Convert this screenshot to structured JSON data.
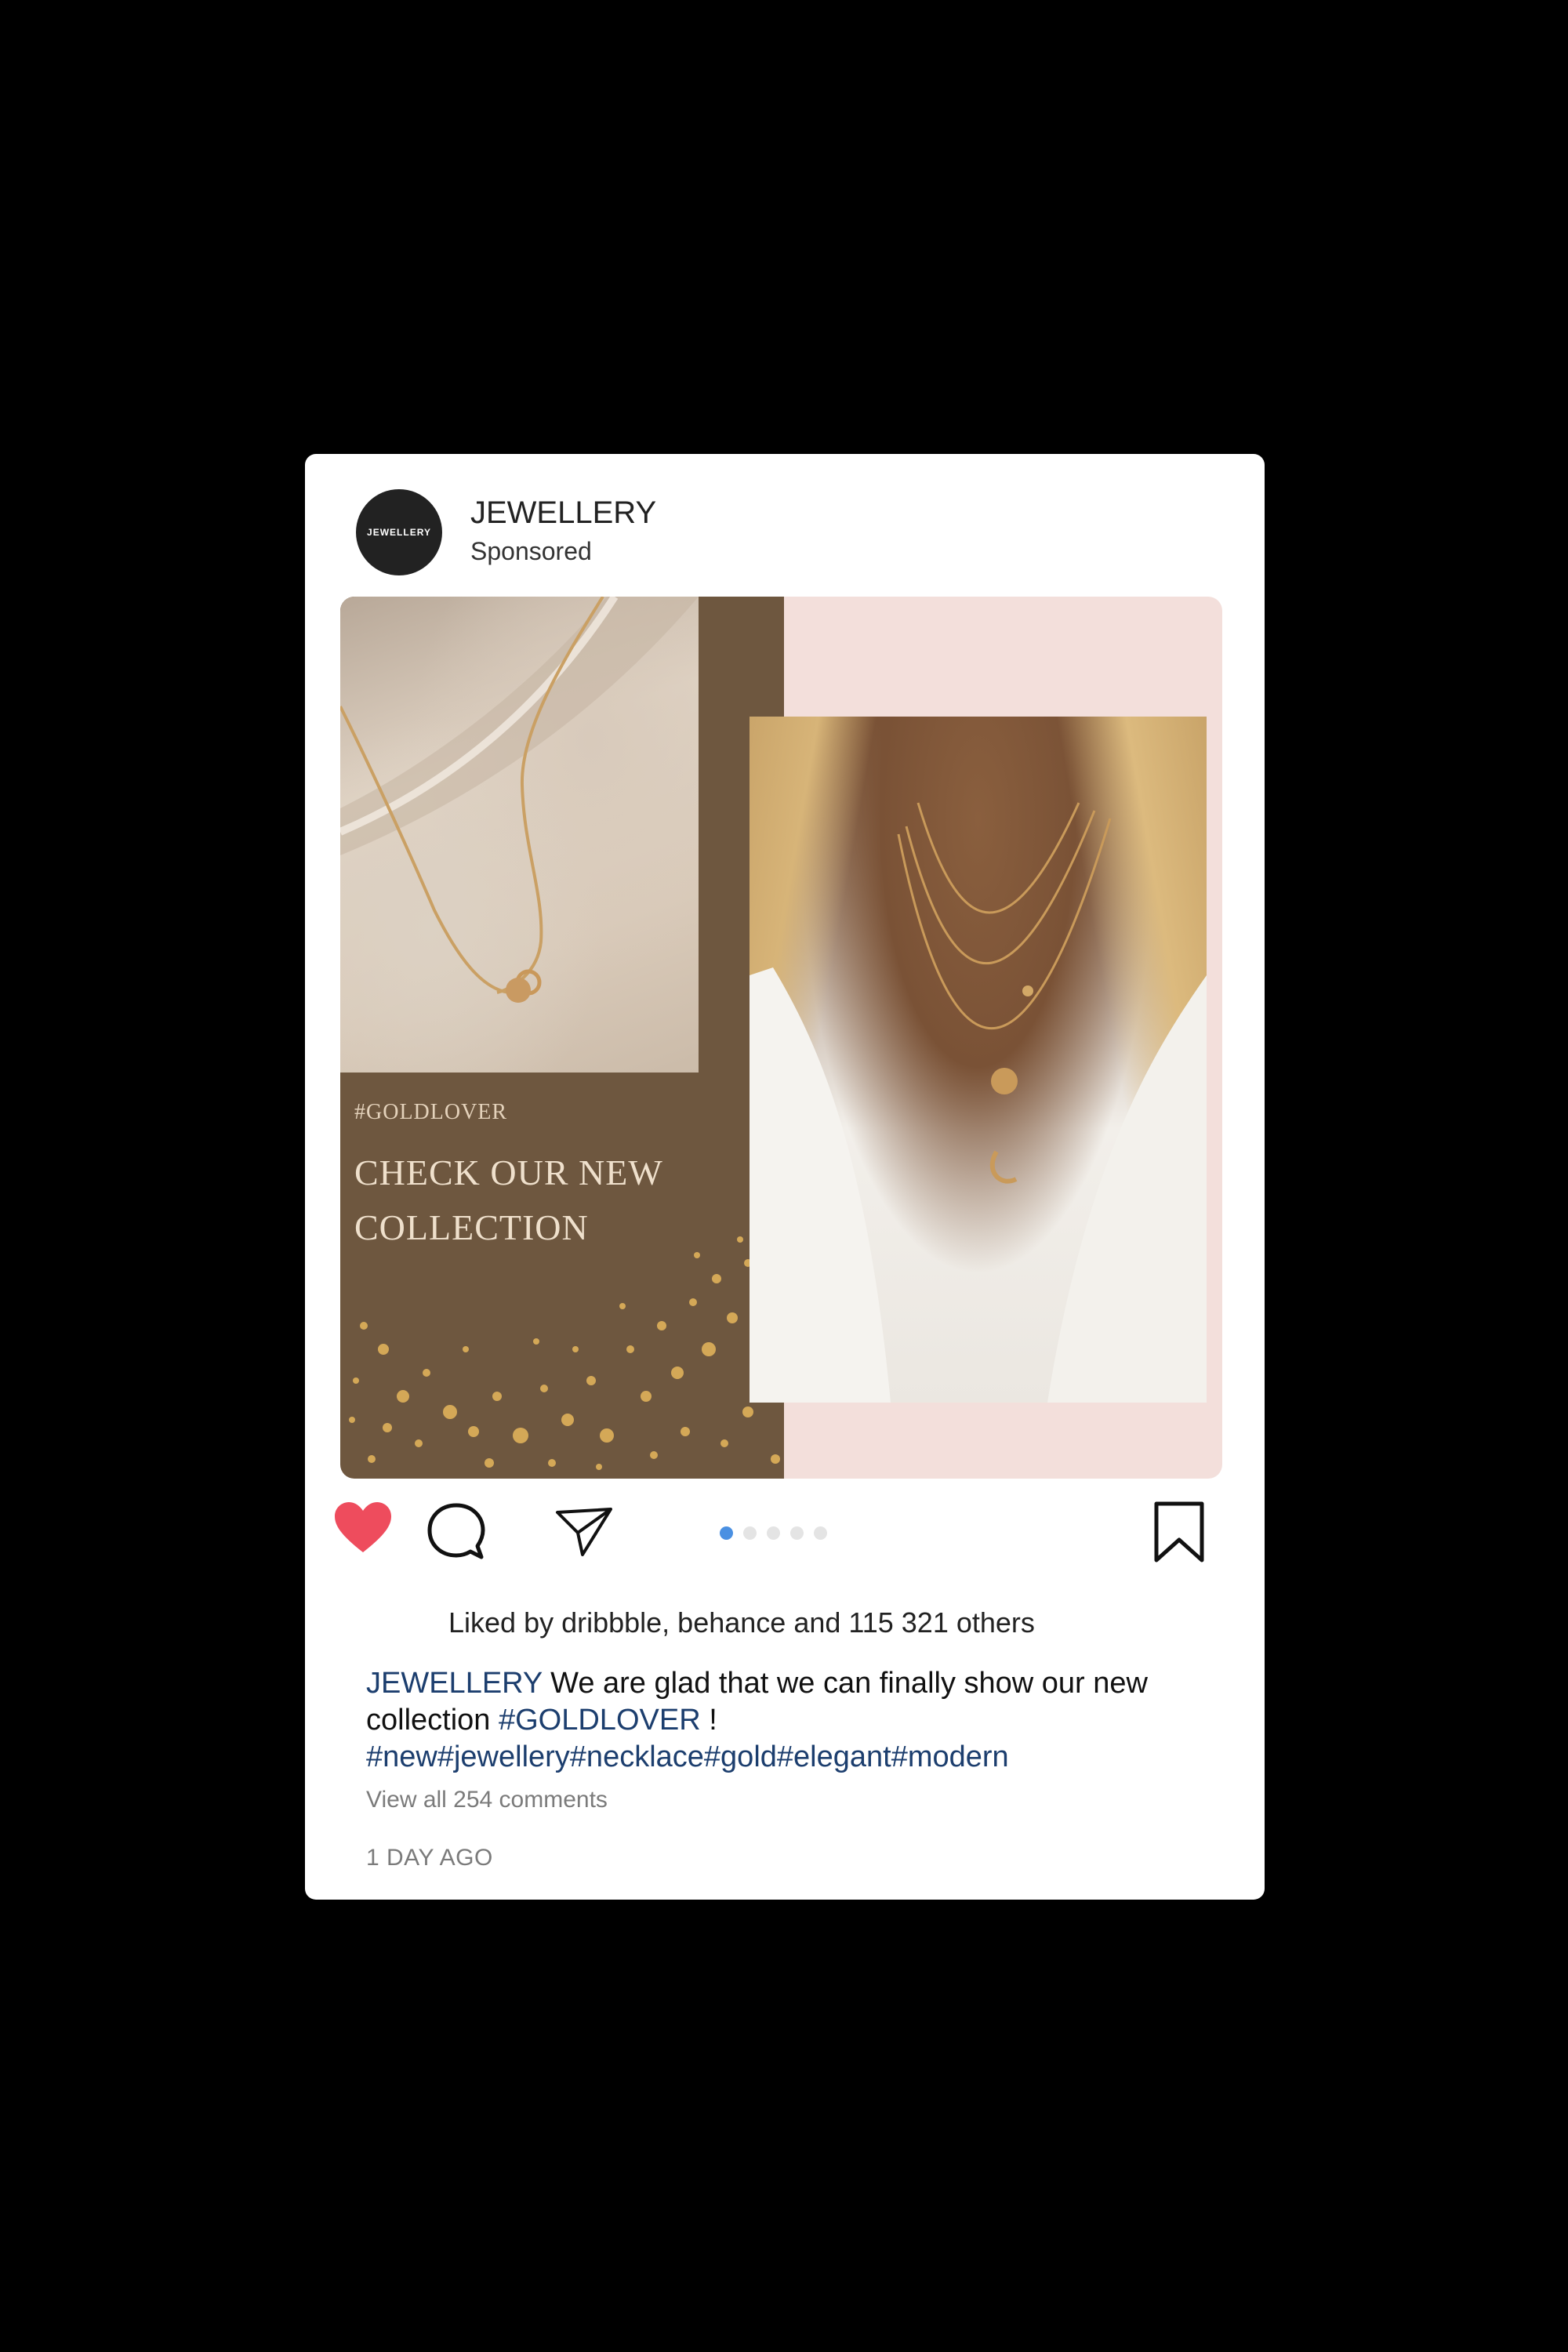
{
  "account": {
    "name": "JEWELLERY",
    "subtitle": "Sponsored",
    "avatar_text": "JEWELLERY"
  },
  "media": {
    "tagline": "#GOLDLOVER",
    "headline": "CHECK OUR NEW COLLECTION",
    "colors": {
      "brown_panel": "#6e573f",
      "pink_background": "#f3dfdb",
      "gold": "#d4a857"
    }
  },
  "actions": {
    "like_icon": "heart-icon",
    "comment_icon": "comment-icon",
    "share_icon": "send-icon",
    "save_icon": "bookmark-icon",
    "carousel_total": 5,
    "carousel_active": 1,
    "like_color": "#ee4c5d",
    "active_dot_color": "#4a90e2"
  },
  "likes_text": "Liked by dribbble, behance and 115 321 others",
  "caption": {
    "account": "JEWELLERY",
    "text": " We are glad that we can finally show our new collection ",
    "hashtag": "#GOLDLOVER",
    "end": " !",
    "tags": "#new#jewellery#necklace#gold#elegant#modern"
  },
  "view_comments": "View all 254 comments",
  "timestamp": "1 DAY AGO"
}
